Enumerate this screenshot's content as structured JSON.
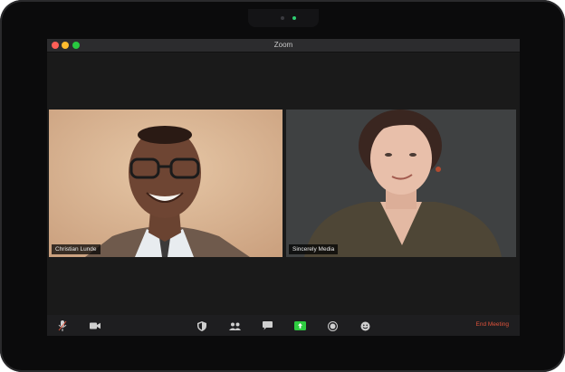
{
  "window": {
    "title": "Zoom"
  },
  "participants": [
    {
      "name": "Christian Lunde",
      "active_speaker": true
    },
    {
      "name": "Sincerely Media",
      "active_speaker": false
    }
  ],
  "toolbar": {
    "icons": [
      "microphone-icon",
      "video-camera-icon",
      "security-shield-icon",
      "participants-icon",
      "chat-icon",
      "share-screen-icon",
      "record-icon",
      "reactions-icon"
    ],
    "end_label": "End Meeting"
  },
  "colors": {
    "active_border": "#d6e05a",
    "share_green": "#2ecc40",
    "end_red": "#e0533b"
  }
}
